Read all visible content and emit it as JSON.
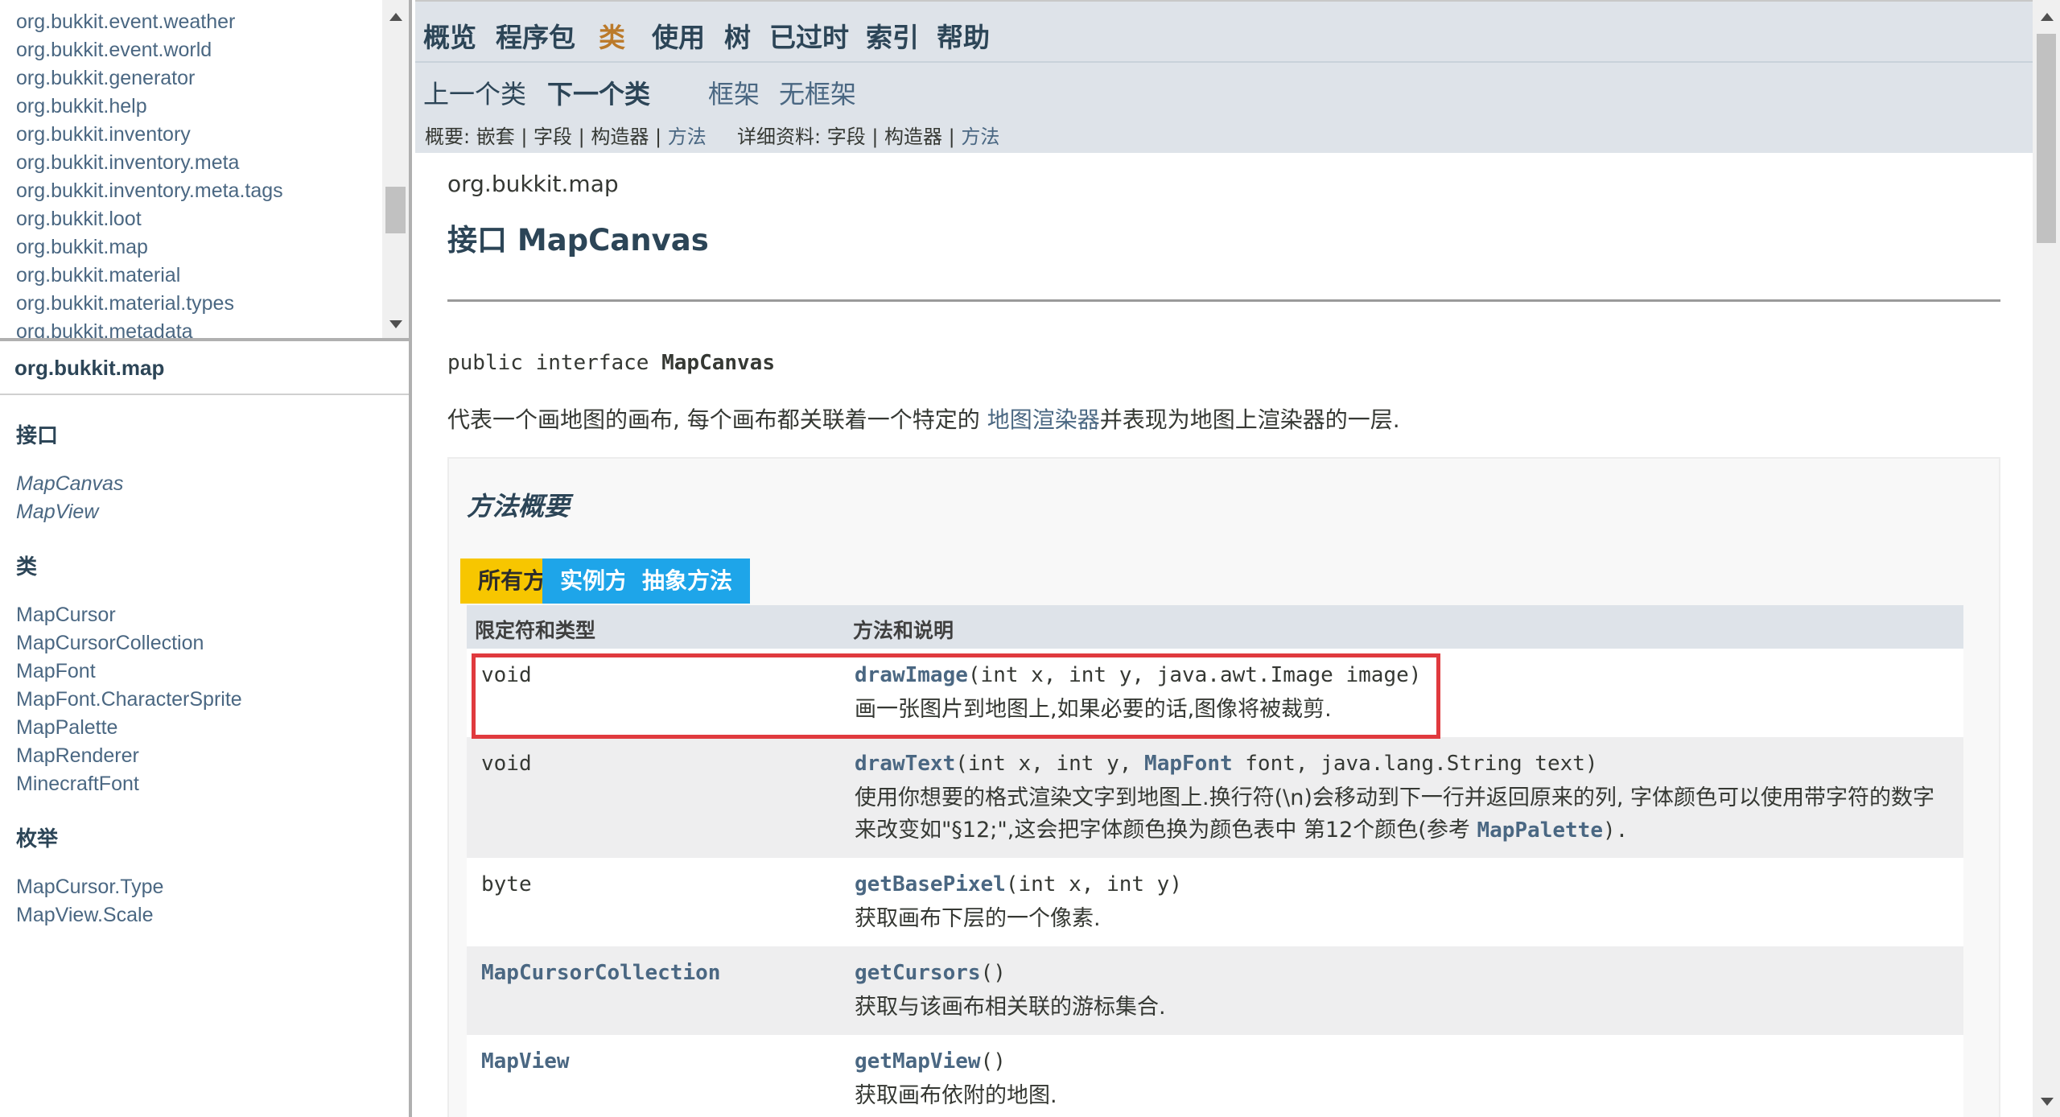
{
  "left_top": {
    "packages": [
      "org.bukkit.event.weather",
      "org.bukkit.event.world",
      "org.bukkit.generator",
      "org.bukkit.help",
      "org.bukkit.inventory",
      "org.bukkit.inventory.meta",
      "org.bukkit.inventory.meta.tags",
      "org.bukkit.loot",
      "org.bukkit.map",
      "org.bukkit.material",
      "org.bukkit.material.types",
      "org.bukkit.metadata"
    ]
  },
  "left_bottom": {
    "package_title": "org.bukkit.map",
    "interfaces_heading": "接口",
    "interfaces": [
      "MapCanvas",
      "MapView"
    ],
    "classes_heading": "类",
    "classes": [
      "MapCursor",
      "MapCursorCollection",
      "MapFont",
      "MapFont.CharacterSprite",
      "MapPalette",
      "MapRenderer",
      "MinecraftFont"
    ],
    "enums_heading": "枚举",
    "enums": [
      "MapCursor.Type",
      "MapView.Scale"
    ]
  },
  "topnav": {
    "overview": "概览",
    "package": "程序包",
    "class": "类",
    "use": "使用",
    "tree": "树",
    "deprecated": "已过时",
    "index": "索引",
    "help": "帮助"
  },
  "subnav": {
    "prev_class": "上一个类",
    "next_class": "下一个类",
    "frames": "框架",
    "no_frames": "无框架",
    "summary_prefix": "概要: 嵌套 | 字段 | 构造器 | ",
    "summary_method": "方法",
    "detail_prefix": "详细资料: 字段 | 构造器 | ",
    "detail_method": "方法"
  },
  "header": {
    "package_label": "org.bukkit.map",
    "title": "接口 MapCanvas",
    "signature_prefix": "public interface ",
    "signature_name": "MapCanvas",
    "description_before": "代表一个画地图的画布, 每个画布都关联着一个特定的 ",
    "description_link": "地图渲染器",
    "description_after": "并表现为地图上渲染器的一层."
  },
  "method_summary": {
    "title": "方法概要",
    "tabs": [
      "所有方法",
      "实例方法",
      "抽象方法"
    ],
    "col_type": "限定符和类型",
    "col_method": "方法和说明",
    "rows": [
      {
        "type": "void",
        "name": "drawImage",
        "params": "(int x, int y, java.awt.Image image)",
        "desc": "画一张图片到地图上,如果必要的话,图像将被裁剪."
      },
      {
        "type": "void",
        "name": "drawText",
        "params_a": "(int x, int y, ",
        "params_link": "MapFont",
        "params_b": " font, java.lang.String text)",
        "desc_a": "使用你想要的格式渲染文字到地图上.换行符(\\n)会移动到下一行并返回原来的列, 字体颜色可以使用带字符的数字来改变如\"§12;\",这会把字体颜色换为颜色表中 第12个颜色(参考 ",
        "desc_link": "MapPalette",
        "desc_b": ")."
      },
      {
        "type": "byte",
        "name": "getBasePixel",
        "params": "(int x, int y)",
        "desc": "获取画布下层的一个像素."
      },
      {
        "type": "MapCursorCollection",
        "name": "getCursors",
        "params": "()",
        "desc": "获取与该画布相关联的游标集合."
      },
      {
        "type": "MapView",
        "name": "getMapView",
        "params": "()",
        "desc": "获取画布依附的地图."
      }
    ]
  }
}
